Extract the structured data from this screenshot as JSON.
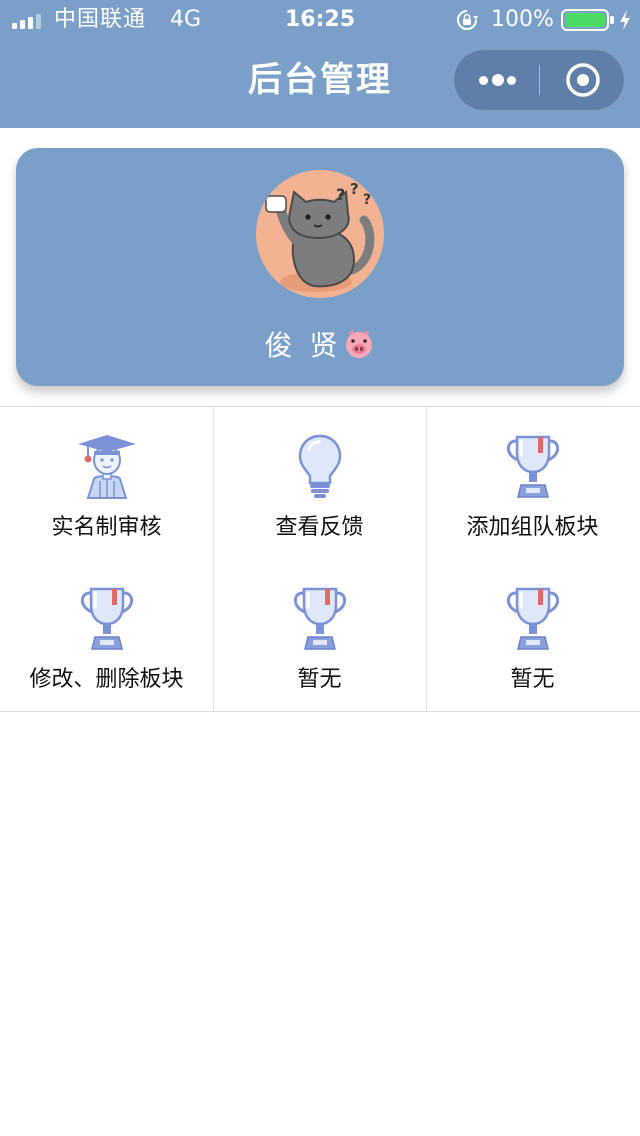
{
  "status_bar": {
    "carrier": "中国联通",
    "network": "4G",
    "time": "16:25",
    "battery_percent": "100%"
  },
  "nav": {
    "title": "后台管理",
    "more_icon": "more-dots-icon",
    "close_icon": "target-circle-icon"
  },
  "profile": {
    "username": "俊 贤",
    "avatar_icon": "cat-avatar-icon",
    "emoji_icon": "pig-face-icon"
  },
  "menu": {
    "items": [
      {
        "label": "实名制审核",
        "icon": "graduate-icon"
      },
      {
        "label": "查看反馈",
        "icon": "lightbulb-icon"
      },
      {
        "label": "添加组队板块",
        "icon": "trophy-icon"
      },
      {
        "label": "修改、删除板块",
        "icon": "trophy-icon"
      },
      {
        "label": "暂无",
        "icon": "trophy-icon"
      },
      {
        "label": "暂无",
        "icon": "trophy-icon"
      }
    ]
  },
  "colors": {
    "nav_background": "#7aa0c9",
    "card_background": "#7aa0c9",
    "battery_green": "#4cd964",
    "icon_blue": "#7b93d6",
    "icon_light": "#dfe8fa",
    "accent_red": "#e06a6a"
  }
}
